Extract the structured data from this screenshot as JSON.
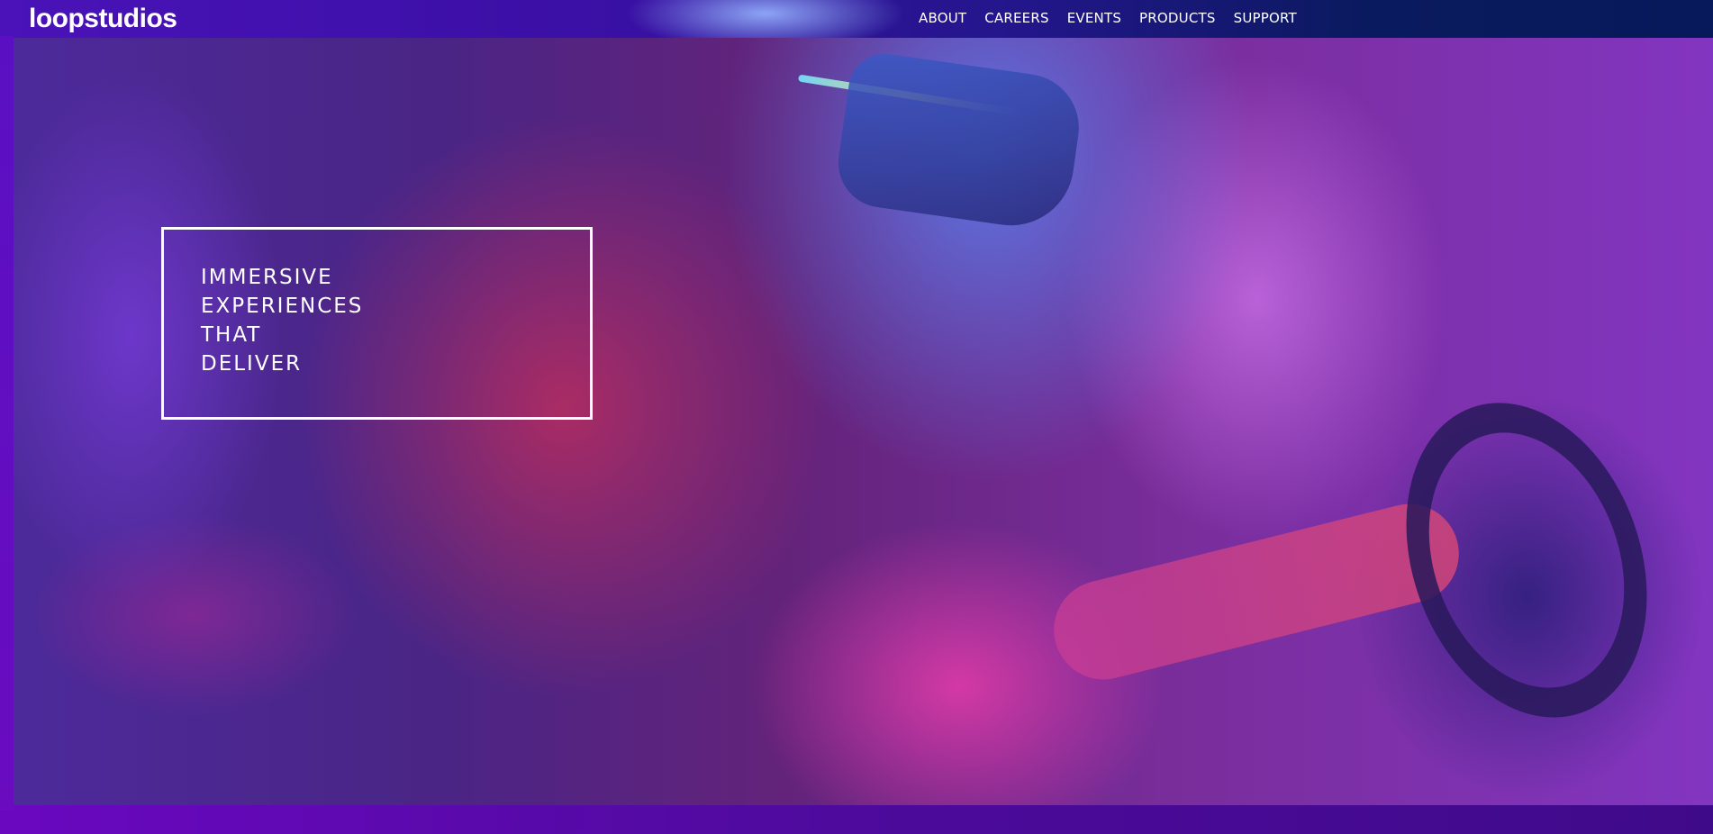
{
  "header": {
    "logo": "loopstudios",
    "nav": [
      {
        "label": "ABOUT"
      },
      {
        "label": "CAREERS"
      },
      {
        "label": "EVENTS"
      },
      {
        "label": "PRODUCTS"
      },
      {
        "label": "SUPPORT"
      }
    ]
  },
  "hero": {
    "title_lines": [
      "IMMERSIVE",
      "EXPERIENCES",
      "THAT",
      "DELIVER"
    ],
    "image": "vr-headset-driving-simulator-photo"
  },
  "colors": {
    "text": "#ffffff",
    "header_left": "#4a12b8",
    "header_right": "#07195a",
    "page_bottom": "#6a08c0"
  }
}
